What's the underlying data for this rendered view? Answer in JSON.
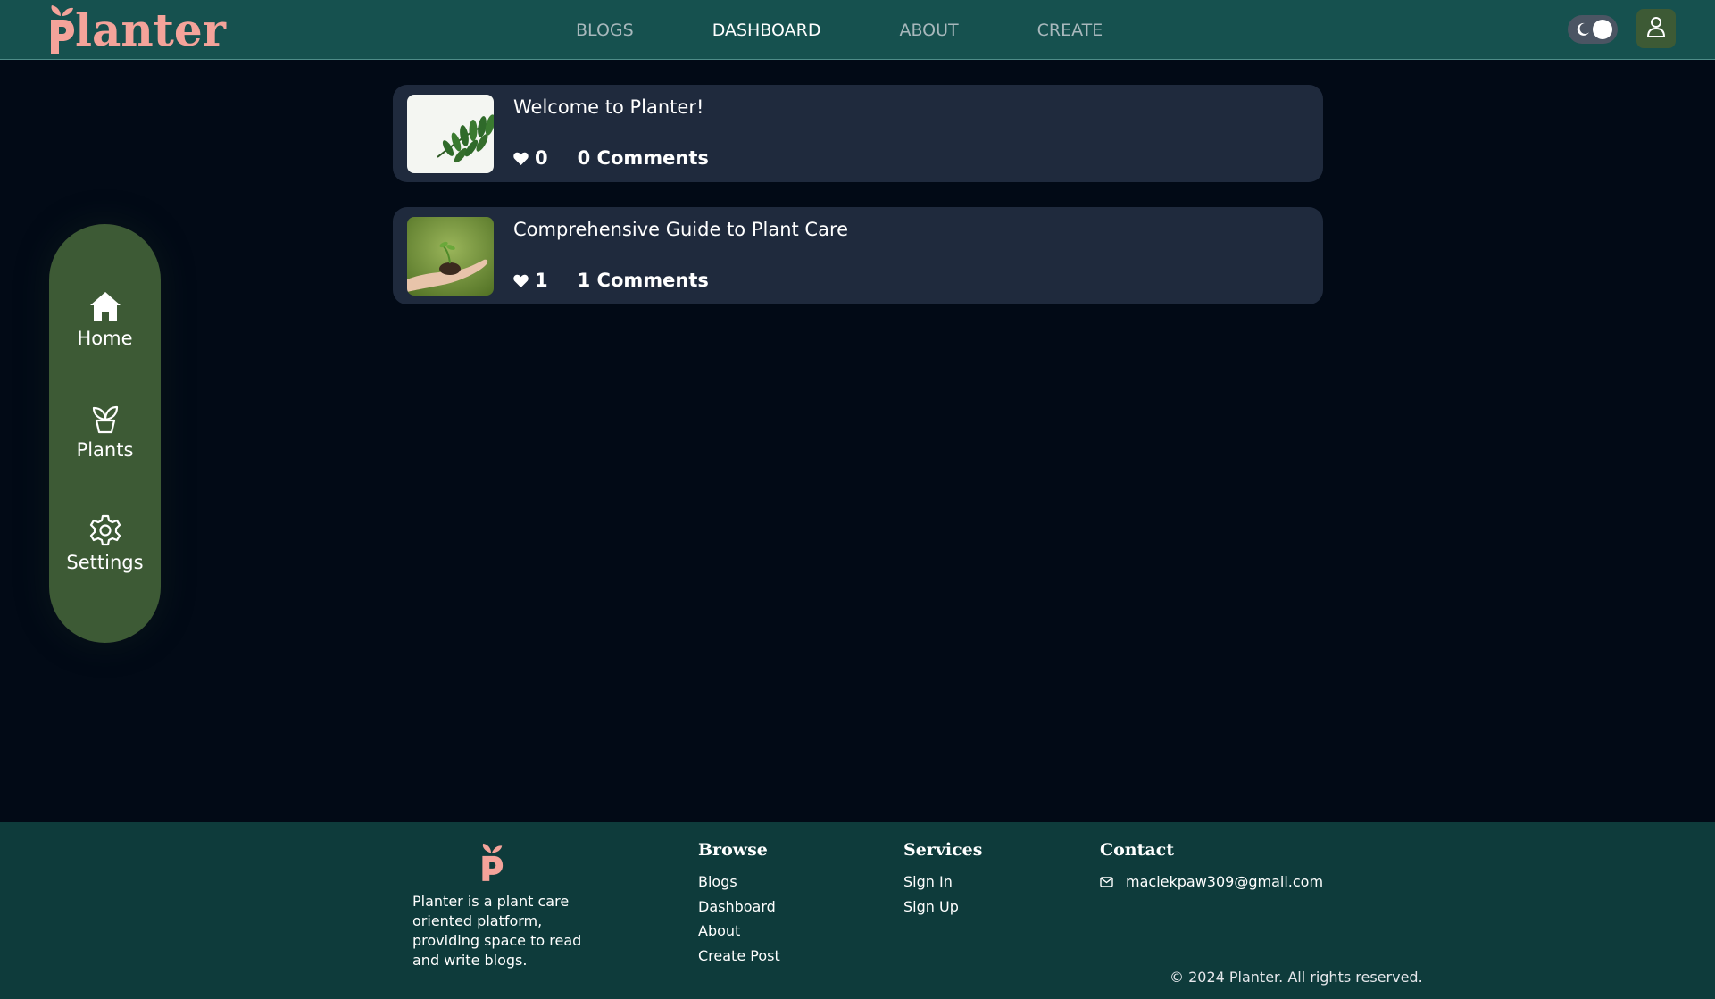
{
  "header": {
    "logo_text": "lanter",
    "nav": [
      {
        "label": "BLOGS",
        "active": false
      },
      {
        "label": "DASHBOARD",
        "active": true
      },
      {
        "label": "ABOUT",
        "active": false
      },
      {
        "label": "CREATE",
        "active": false
      }
    ],
    "theme_toggle_icon": "moon-icon",
    "user_icon": "user-icon"
  },
  "sidebar": {
    "items": [
      {
        "label": "Home",
        "icon": "home-icon"
      },
      {
        "label": "Plants",
        "icon": "plant-pot-icon"
      },
      {
        "label": "Settings",
        "icon": "gear-icon"
      }
    ]
  },
  "posts": [
    {
      "title": "Welcome to Planter!",
      "likes": "0",
      "comments": "0 Comments"
    },
    {
      "title": "Comprehensive Guide to Plant Care",
      "likes": "1",
      "comments": "1 Comments"
    }
  ],
  "footer": {
    "description": "Planter is a plant care oriented platform, providing space to read and write blogs.",
    "browse": {
      "heading": "Browse",
      "links": [
        "Blogs",
        "Dashboard",
        "About",
        "Create Post"
      ]
    },
    "services": {
      "heading": "Services",
      "links": [
        "Sign In",
        "Sign Up"
      ]
    },
    "contact": {
      "heading": "Contact",
      "email": "maciekpaw309@gmail.com"
    },
    "copyright": "© 2024 Planter. All rights reserved."
  },
  "colors": {
    "header_bg": "#16514f",
    "page_bg": "#020a16",
    "card_bg": "#1f2a3d",
    "sidebar_bg": "#3d5a35",
    "footer_bg": "#0e3b3b",
    "logo": "#f4a39a"
  }
}
